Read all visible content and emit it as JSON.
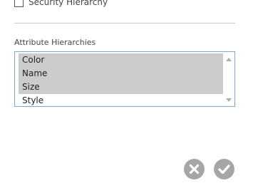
{
  "security": {
    "checkbox_label": "Security Hierarchy",
    "checked": false
  },
  "attribute_hierarchies": {
    "title": "Attribute Hierarchies",
    "items": [
      {
        "label": "Color",
        "selected": true
      },
      {
        "label": "Name",
        "selected": true
      },
      {
        "label": "Size",
        "selected": true
      },
      {
        "label": "Style",
        "selected": false
      }
    ]
  },
  "actions": {
    "cancel_icon": "close-icon",
    "confirm_icon": "checkmark-icon"
  },
  "colors": {
    "selection": "#cccccc",
    "listbox_border": "#7aa7d6",
    "action_button": "#a6a6a6"
  }
}
